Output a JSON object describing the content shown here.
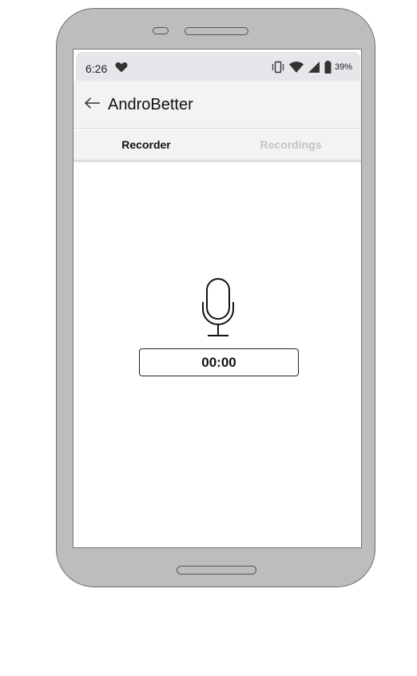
{
  "status_bar": {
    "time": "6:26",
    "battery_percent": "39%",
    "icons": [
      "heart-icon",
      "vibrate-icon",
      "wifi-icon",
      "signal-icon",
      "battery-icon"
    ]
  },
  "app_bar": {
    "title": "AndroBetter",
    "back_icon": "arrow-left-icon"
  },
  "tabs": [
    {
      "label": "Recorder",
      "active": true
    },
    {
      "label": "Recordings",
      "active": false
    }
  ],
  "recorder": {
    "icon": "microphone-icon",
    "timer": "00:00"
  },
  "colors": {
    "device_body": "#bdbdbd",
    "status_bar": "#e5e7ea",
    "app_bar": "#f3f3f3",
    "inactive_tab": "#c4c4c4"
  }
}
